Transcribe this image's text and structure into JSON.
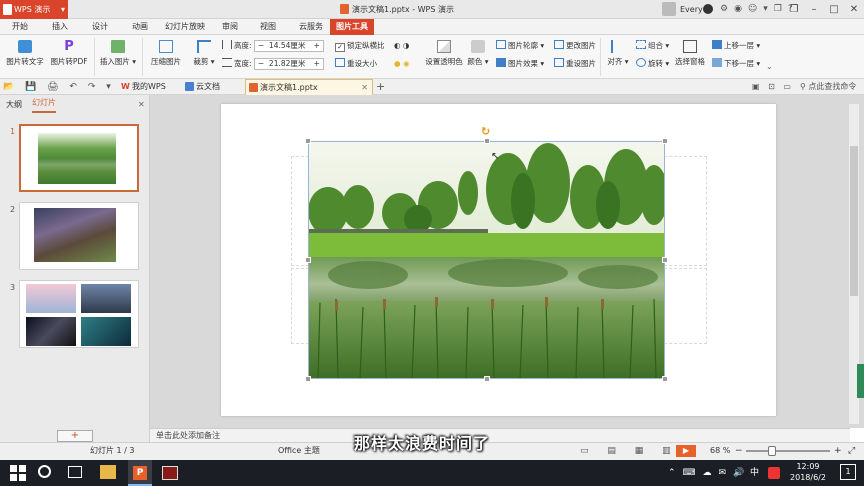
{
  "app": {
    "name": "WPS 演示",
    "doc_title": "演示文稿1.pptx - WPS 演示",
    "user": "Every"
  },
  "menu": [
    "开始",
    "插入",
    "设计",
    "动画",
    "幻灯片放映",
    "审阅",
    "视图",
    "云服务",
    "图片工具"
  ],
  "active_menu": "图片工具",
  "ribbon": {
    "pic_to_text": "图片转文字",
    "pic_to_pdf": "图片转PDF",
    "insert_pic": "插入图片",
    "compress": "压缩图片",
    "crop": "裁剪",
    "height_label": "高度:",
    "height_value": "14.54厘米",
    "width_label": "宽度:",
    "width_value": "21.82厘米",
    "lock_ratio": "锁定纵横比",
    "reset_size": "重设大小",
    "set_transparent": "设置透明色",
    "color": "颜色",
    "outline": "图片轮廓",
    "effects": "图片效果",
    "change_pic": "更改图片",
    "reset_pic": "重设图片",
    "align": "对齐",
    "group": "组合",
    "rotate": "旋转",
    "select_pane": "选择窗格",
    "bring_forward": "上移一层",
    "send_backward": "下移一层"
  },
  "tabs": {
    "mywps": "我的WPS",
    "cloud": "云文档",
    "doc": "演示文稿1.pptx",
    "search": "点此查找命令"
  },
  "left_panel": {
    "outline_tab": "大纲",
    "slides_tab": "幻灯片",
    "slide_numbers": [
      "1",
      "2",
      "3"
    ]
  },
  "notes_placeholder": "单击此处添加备注",
  "status": {
    "slide_info": "幻灯片 1 / 3",
    "theme": "Office 主题",
    "zoom": "68 %"
  },
  "subtitle": "那样太浪费时间了",
  "taskbar": {
    "time": "12:09",
    "date": "2018/6/2",
    "ime": "中",
    "notify_count": "1"
  },
  "colors": {
    "accent": "#d9442a",
    "selected_thumb_border": "#c96a3a"
  }
}
